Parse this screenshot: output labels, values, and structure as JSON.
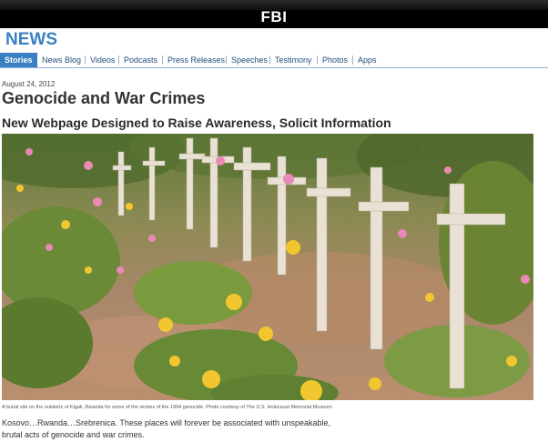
{
  "header": {
    "brand": "FBI"
  },
  "section": {
    "title": "NEWS"
  },
  "nav": {
    "items": [
      {
        "label": "Stories",
        "active": true
      },
      {
        "label": "News Blog"
      },
      {
        "label": "Videos"
      },
      {
        "label": "Podcasts"
      },
      {
        "label": "Press Releases"
      },
      {
        "label": "Speeches"
      },
      {
        "label": "Testimony"
      },
      {
        "label": "Photos"
      },
      {
        "label": "Apps"
      }
    ]
  },
  "article": {
    "date": "August 24, 2012",
    "title": "Genocide and War Crimes",
    "subtitle": "New Webpage Designed to Raise Awareness, Solicit Information",
    "image_caption": "A burial site on the outskirts of Kigali, Rwanda for some of the victims of the 1994 genocide. Photo courtesy of The U.S. Holocaust Memorial Museum",
    "body_line1": "Kosovo…Rwanda…Srebrenica. These places will forever be associated with unspeakable,",
    "body_line2": "brutal acts of genocide and war crimes."
  },
  "colors": {
    "topbar": "#000000",
    "brand_text": "#ffffff",
    "section_title": "#3a7fc1",
    "nav_active_bg": "#3a7fc1",
    "nav_link": "#1f4e7b"
  }
}
